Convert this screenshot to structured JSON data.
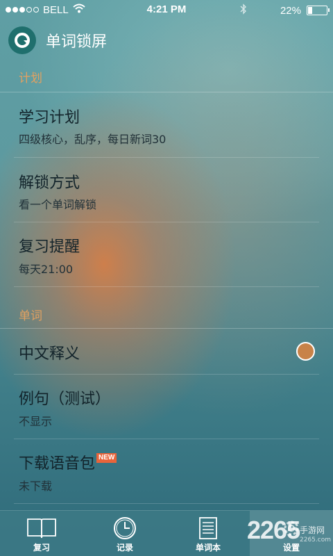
{
  "status_bar": {
    "carrier": "BELL",
    "time": "4:21 PM",
    "battery": "22%",
    "battery_level": 0.22
  },
  "app": {
    "title": "单词锁屏",
    "logo_icon": "app-logo-icon"
  },
  "sections": {
    "plan": {
      "header": "计划",
      "study_plan": {
        "title": "学习计划",
        "subtitle": "四级核心，乱序，每日新词30"
      },
      "unlock_mode": {
        "title": "解锁方式",
        "subtitle": "看一个单词解锁"
      },
      "review_reminder": {
        "title": "复习提醒",
        "subtitle": "每天21:00"
      }
    },
    "words": {
      "header": "单词",
      "chinese_definition": {
        "title": "中文释义",
        "enabled": true
      },
      "example_sentences": {
        "title": "例句（测试）",
        "subtitle": "不显示"
      },
      "download_audio": {
        "title": "下载语音包",
        "badge": "NEW",
        "subtitle": "未下载"
      }
    }
  },
  "tabs": [
    {
      "label": "复习",
      "icon": "book-icon"
    },
    {
      "label": "记录",
      "icon": "clock-icon"
    },
    {
      "label": "单词本",
      "icon": "notebook-icon"
    },
    {
      "label": "设置",
      "icon": "settings-icon",
      "active": true
    }
  ],
  "watermark": {
    "brand": "2265",
    "text": "手游网",
    "url": "2265.com"
  },
  "colors": {
    "accent": "#e3a160",
    "radio_fill": "#c88248",
    "badge": "#e9643a",
    "logo_bg": "#1f6f6d"
  }
}
